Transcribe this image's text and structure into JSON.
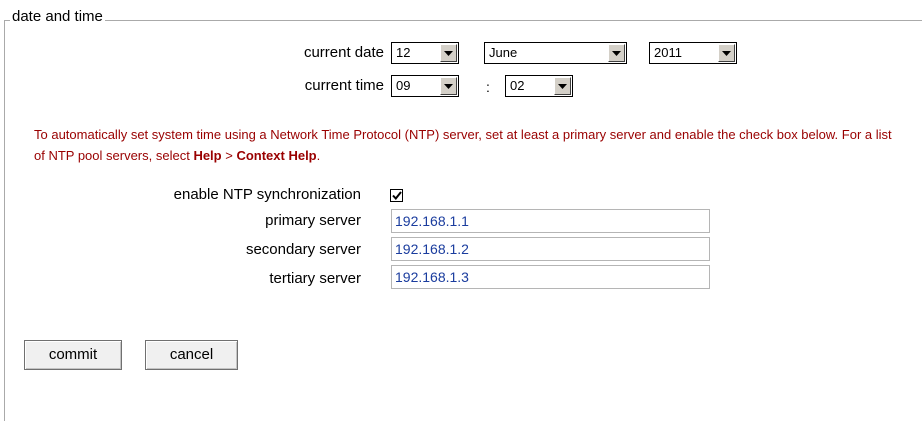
{
  "section": {
    "title": "date and time"
  },
  "date": {
    "label": "current date",
    "day": "12",
    "month": "June",
    "year": "2011"
  },
  "time": {
    "label": "current time",
    "hour": "09",
    "separator": ":",
    "minute": "02"
  },
  "note": {
    "text_before": "To automatically set system time using a Network Time Protocol (NTP) server, set at least a primary server and enable the check box below. For a list of NTP pool servers, select ",
    "help": "Help",
    "arrow": ">",
    "context_help": "Context Help",
    "period": "."
  },
  "ntp": {
    "enable_label": "enable NTP synchronization",
    "enabled": true,
    "primary_label": "primary server",
    "primary_value": "192.168.1.1",
    "secondary_label": "secondary server",
    "secondary_value": "192.168.1.2",
    "tertiary_label": "tertiary server",
    "tertiary_value": "192.168.1.3"
  },
  "actions": {
    "commit": "commit",
    "cancel": "cancel"
  },
  "colors": {
    "note": "#990000",
    "input_text": "#1a3c9e",
    "button_face": "#d4d0c8"
  },
  "icons": {
    "dropdown": "triangle-down-icon",
    "check": "checkmark-icon"
  }
}
